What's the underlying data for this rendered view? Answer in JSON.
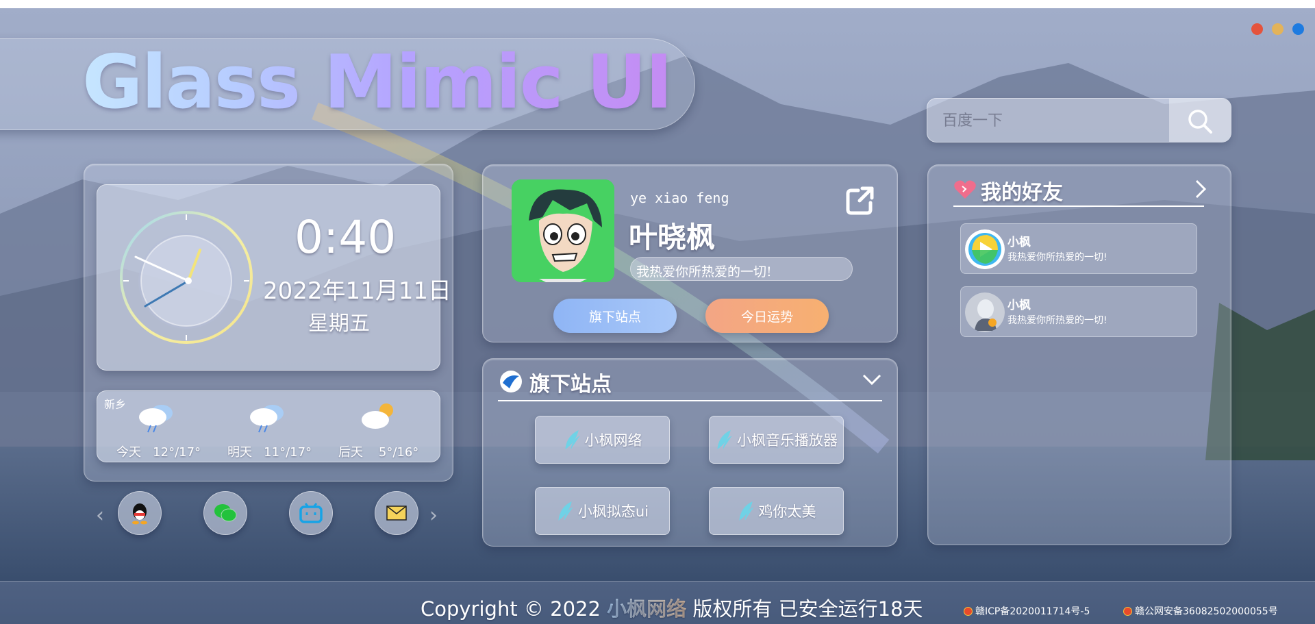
{
  "window_dots": [
    "#e5533c",
    "#e3b35a",
    "#1e7be0"
  ],
  "header": {
    "title": "Glass Mimic UI"
  },
  "search": {
    "placeholder": "百度一下",
    "button_icon": "search-icon"
  },
  "clock": {
    "time": "0:40",
    "date": "2022年11月11日",
    "weekday": "星期五"
  },
  "weather": {
    "city": "新乡",
    "days": [
      {
        "label": "今天",
        "temp": "12°/17°",
        "icon": "rain-cloud-icon"
      },
      {
        "label": "明天",
        "temp": "11°/17°",
        "icon": "rain-cloud-icon"
      },
      {
        "label": "后天",
        "temp": "5°/16°",
        "icon": "sun-cloud-icon"
      }
    ]
  },
  "social": [
    "qq-icon",
    "wechat-icon",
    "bilibili-icon",
    "mail-icon"
  ],
  "profile": {
    "pinyin": "ye xiao feng",
    "name": "叶晓枫",
    "motto": "我热爱你所热爱的一切!",
    "buttons": {
      "sites": "旗下站点",
      "fortune": "今日运势"
    }
  },
  "sites": {
    "title": "旗下站点",
    "items": [
      "小枫网络",
      "小枫音乐播放器",
      "小枫拟态ui",
      "鸡你太美"
    ]
  },
  "friends": {
    "title": "我的好友",
    "list": [
      {
        "name": "小枫",
        "msg": "我热爱你所热爱的一切!"
      },
      {
        "name": "小枫",
        "msg": "我热爱你所热爱的一切!"
      }
    ]
  },
  "footer": {
    "pre": "Copyright © 2022 ",
    "brand": "小枫网络",
    "post": " 版权所有 已安全运行18天",
    "icp1": "赣ICP备2020011714号-5",
    "icp2": "赣公网安备36082502000055号"
  }
}
